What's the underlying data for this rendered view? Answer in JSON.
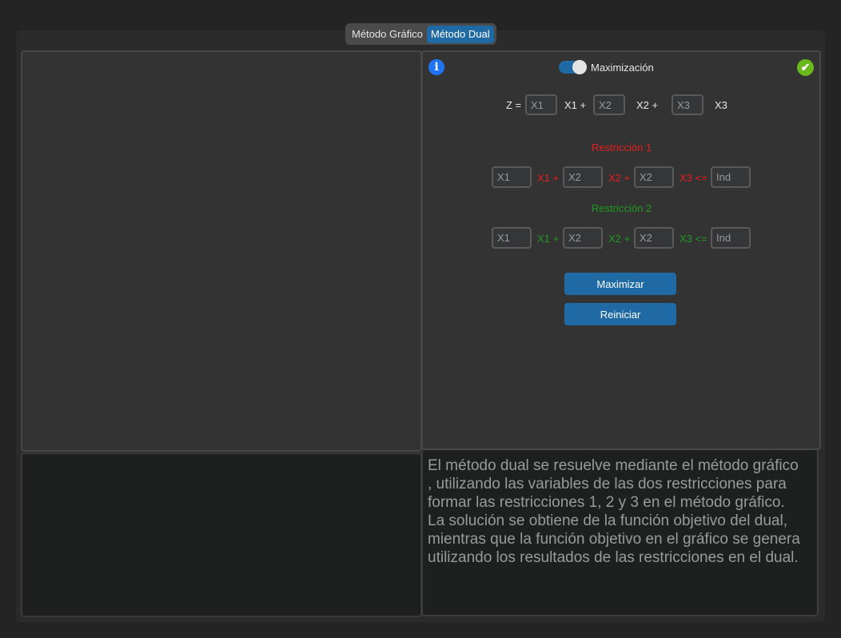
{
  "tabs": [
    {
      "label": "Método Gráfico",
      "active": false
    },
    {
      "label": "Método Dual",
      "active": true
    }
  ],
  "controls": {
    "info_icon": "i",
    "mode_toggle_label": "Maximización",
    "mode_toggle_on": true,
    "status_icon": "✔"
  },
  "objective": {
    "prefix": "Z =",
    "x1_placeholder": "X1",
    "x1_label": "X1 +",
    "x2_placeholder": "X2",
    "x2_label": "X2 +",
    "x3_placeholder": "X3",
    "x3_label": "X3"
  },
  "restriction1": {
    "title": "Restricción 1",
    "x1_placeholder": "X1",
    "x1_label": "X1 +",
    "x2_placeholder": "X2",
    "x2_label": "X2 +",
    "x3_placeholder": "X2",
    "x3_label": "X3 <=",
    "ind_placeholder": "Ind"
  },
  "restriction2": {
    "title": "Restricción 2",
    "x1_placeholder": "X1",
    "x1_label": "X1 +",
    "x2_placeholder": "X2",
    "x2_label": "X2 +",
    "x3_placeholder": "X2",
    "x3_label": "X3 <=",
    "ind_placeholder": "Ind"
  },
  "buttons": {
    "maximize": "Maximizar",
    "reset": "Reiniciar"
  },
  "description": "El método dual se resuelve mediante el método gráfico\n, utilizando las variables de las dos restricciones para\nformar las restricciones 1, 2 y 3 en el método gráfico.\nLa solución se obtiene de la función objetivo del dual,\nmientras que la función objetivo en el gráfico se genera\nutilizando los resultados de las restricciones en el dual.",
  "colors": {
    "accent": "#1f6aa5",
    "restriction1": "#e81c1c",
    "restriction2": "#1f9a1f",
    "success": "#69b81b",
    "info": "#1e74f5"
  }
}
